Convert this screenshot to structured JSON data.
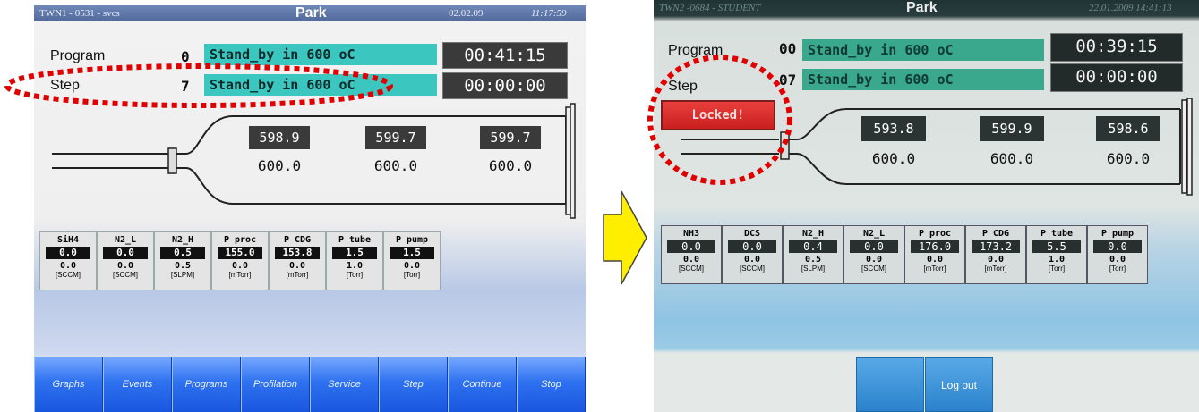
{
  "left_panel": {
    "title": {
      "system": "TWN1 - 0531 - svcs",
      "screen": "Park",
      "date": "02.02.09",
      "time": "11:17:59"
    },
    "program": {
      "label": "Program",
      "number": "0",
      "name": "Stand_by in 600 oC",
      "timer": "00:41:15"
    },
    "step": {
      "label": "Step",
      "number": "7",
      "name": "Stand_by in 600 oC",
      "timer": "00:00:00"
    },
    "temperatures": [
      {
        "actual": "598.9",
        "setpoint": "600.0"
      },
      {
        "actual": "599.7",
        "setpoint": "600.0"
      },
      {
        "actual": "599.7",
        "setpoint": "600.0"
      }
    ],
    "gases": [
      {
        "name": "SiH4",
        "actual": "0.0",
        "set": "0.0",
        "unit": "[SCCM]"
      },
      {
        "name": "N2_L",
        "actual": "0.0",
        "set": "0.0",
        "unit": "[SCCM]"
      },
      {
        "name": "N2_H",
        "actual": "0.5",
        "set": "0.5",
        "unit": "[SLPM]"
      },
      {
        "name": "P proc",
        "actual": "155.0",
        "set": "0.0",
        "unit": "[mTorr]"
      },
      {
        "name": "P CDG",
        "actual": "153.8",
        "set": "0.0",
        "unit": "[mTorr]"
      },
      {
        "name": "P tube",
        "actual": "1.5",
        "set": "1.0",
        "unit": "[Torr]"
      },
      {
        "name": "P pump",
        "actual": "1.5",
        "set": "0.0",
        "unit": "[Torr]"
      }
    ],
    "buttons": [
      "Graphs",
      "Events",
      "Programs",
      "Profilation",
      "Service",
      "Step",
      "Continue",
      "Stop"
    ]
  },
  "right_panel": {
    "title": {
      "system": "TWN2 -0684 - STUDENT",
      "screen": "Park",
      "datetime": "22.01.2009 14:41:13"
    },
    "program": {
      "label": "Program",
      "number": "00",
      "name": "Stand_by in 600 oC",
      "timer": "00:39:15"
    },
    "step": {
      "label": "Step",
      "number": "07",
      "name": "Stand_by in 600 oC",
      "timer": "00:00:00"
    },
    "locked_label": "Locked!",
    "temperatures": [
      {
        "actual": "593.8",
        "setpoint": "600.0"
      },
      {
        "actual": "599.9",
        "setpoint": "600.0"
      },
      {
        "actual": "598.6",
        "setpoint": "600.0"
      }
    ],
    "gases": [
      {
        "name": "NH3",
        "actual": "0.0",
        "set": "0.0",
        "unit": "[SCCM]"
      },
      {
        "name": "DCS",
        "actual": "0.0",
        "set": "0.0",
        "unit": "[SCCM]"
      },
      {
        "name": "N2_H",
        "actual": "0.4",
        "set": "0.5",
        "unit": "[SLPM]"
      },
      {
        "name": "N2_L",
        "actual": "0.0",
        "set": "0.0",
        "unit": "[SCCM]"
      },
      {
        "name": "P proc",
        "actual": "176.0",
        "set": "0.0",
        "unit": "[mTorr]"
      },
      {
        "name": "P CDG",
        "actual": "173.2",
        "set": "0.0",
        "unit": "[mTorr]"
      },
      {
        "name": "P tube",
        "actual": "5.5",
        "set": "1.0",
        "unit": "[Torr]"
      },
      {
        "name": "P pump",
        "actual": "0.0",
        "set": "0.0",
        "unit": "[Torr]"
      }
    ],
    "logout_label": "Log out"
  },
  "colors": {
    "highlight": "#e00000",
    "arrow": "#ffee00",
    "step_box": "#3cc6c0",
    "button_blue": "#2f72f0"
  }
}
